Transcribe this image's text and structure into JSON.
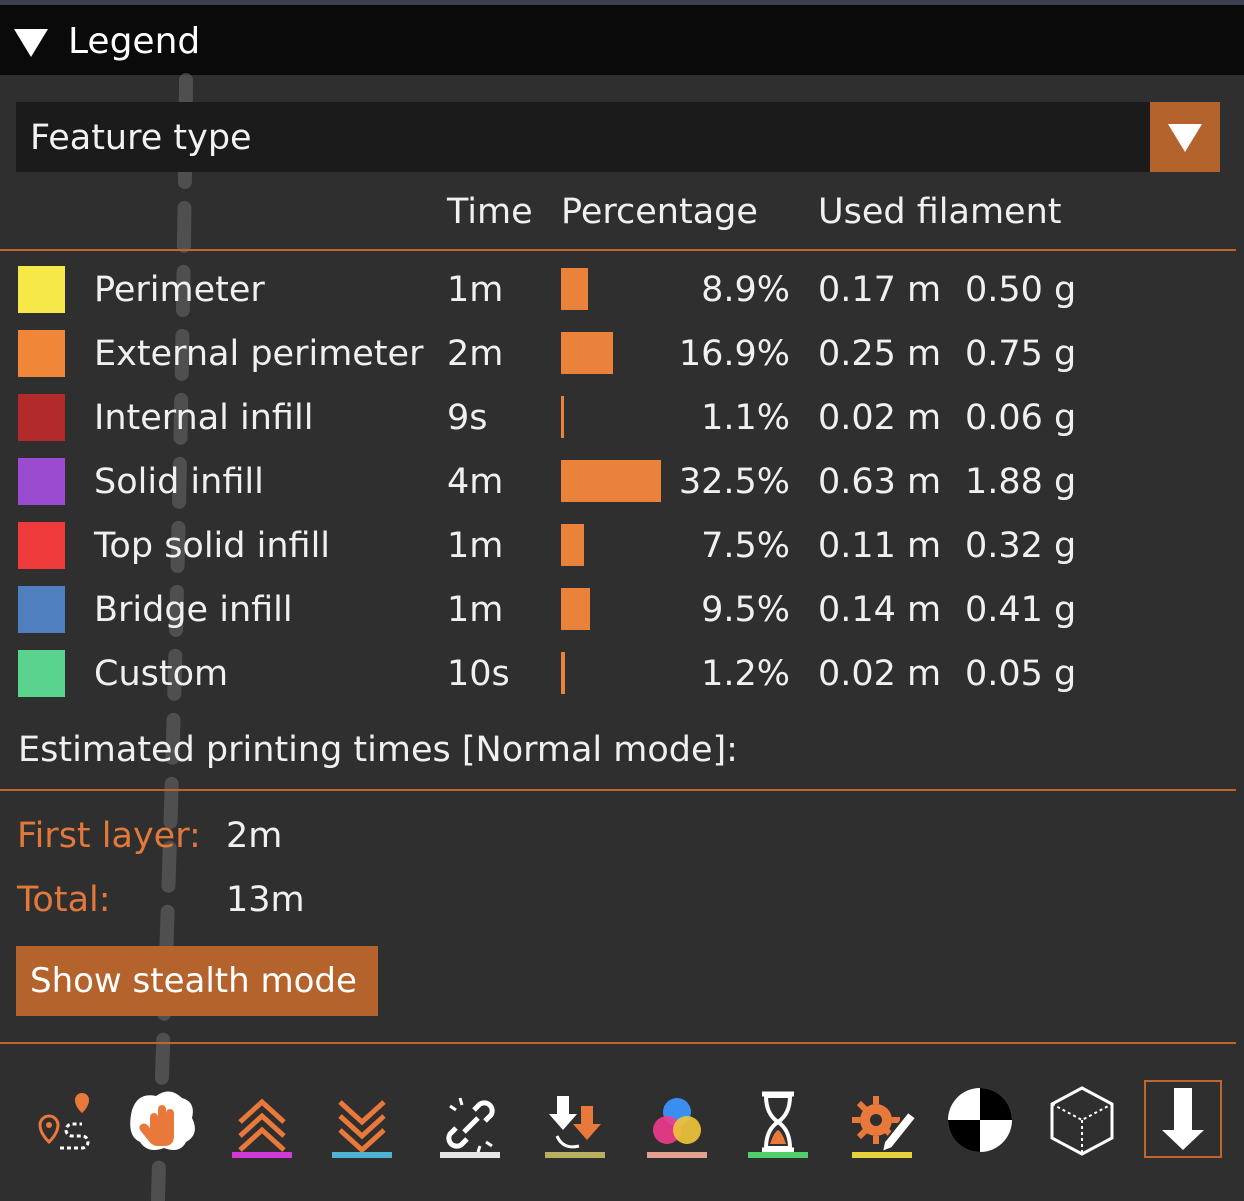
{
  "panel": {
    "title": "Legend"
  },
  "view_type": {
    "selected": "Feature type"
  },
  "columns": {
    "time": "Time",
    "percentage": "Percentage",
    "used_filament": "Used filament"
  },
  "features": [
    {
      "name": "Perimeter",
      "color": "#f7e84a",
      "time": "1m",
      "percent": "8.9%",
      "percent_value": 8.9,
      "length": "0.17 m",
      "weight": "0.50 g"
    },
    {
      "name": "External perimeter",
      "color": "#f08637",
      "time": "2m",
      "percent": "16.9%",
      "percent_value": 16.9,
      "length": "0.25 m",
      "weight": "0.75 g"
    },
    {
      "name": "Internal infill",
      "color": "#b22a2a",
      "time": "9s",
      "percent": "1.1%",
      "percent_value": 1.1,
      "length": "0.02 m",
      "weight": "0.06 g"
    },
    {
      "name": "Solid infill",
      "color": "#9a4bcf",
      "time": "4m",
      "percent": "32.5%",
      "percent_value": 32.5,
      "length": "0.63 m",
      "weight": "1.88 g"
    },
    {
      "name": "Top solid infill",
      "color": "#ef3b3b",
      "time": "1m",
      "percent": "7.5%",
      "percent_value": 7.5,
      "length": "0.11 m",
      "weight": "0.32 g"
    },
    {
      "name": "Bridge infill",
      "color": "#4f7fbf",
      "time": "1m",
      "percent": "9.5%",
      "percent_value": 9.5,
      "length": "0.14 m",
      "weight": "0.41 g"
    },
    {
      "name": "Custom",
      "color": "#5ad38f",
      "time": "10s",
      "percent": "1.2%",
      "percent_value": 1.2,
      "length": "0.02 m",
      "weight": "0.05 g"
    }
  ],
  "estimate": {
    "heading": "Estimated printing times [Normal mode]:",
    "first_layer_label": "First layer:",
    "first_layer_value": "2m",
    "total_label": "Total:",
    "total_value": "13m"
  },
  "stealth_button": {
    "label": "Show stealth mode"
  },
  "toolbar": {
    "items": [
      {
        "icon": "travel-icon",
        "underline": ""
      },
      {
        "icon": "wipe-icon",
        "underline": ""
      },
      {
        "icon": "retractions-icon",
        "underline": "#d13ad9"
      },
      {
        "icon": "deretractions-icon",
        "underline": "#4fb4d4"
      },
      {
        "icon": "seams-icon",
        "underline": "#e6e6e6"
      },
      {
        "icon": "tool-changes-icon",
        "underline": "#b8b060"
      },
      {
        "icon": "color-changes-icon",
        "underline": "#e2a090"
      },
      {
        "icon": "pause-prints-icon",
        "underline": "#4fcf6a"
      },
      {
        "icon": "custom-gcodes-icon",
        "underline": "#e6d23a"
      },
      {
        "icon": "center-of-gravity-icon",
        "underline": ""
      },
      {
        "icon": "shells-icon",
        "underline": ""
      },
      {
        "icon": "tool-marker-icon",
        "underline": ""
      }
    ]
  }
}
